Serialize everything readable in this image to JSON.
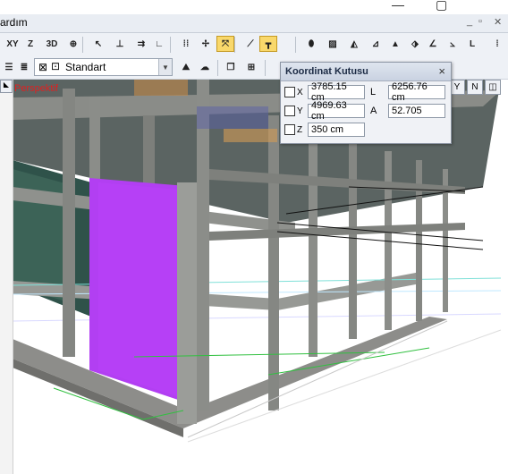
{
  "menu": {
    "partial_label": "ardım"
  },
  "toolbar1": {
    "tools": [
      {
        "name": "view-xy-tool",
        "text": "XY"
      },
      {
        "name": "view-z-tool",
        "text": "Z"
      },
      {
        "name": "view-3d-tool",
        "text": "3D"
      },
      {
        "name": "target-tool",
        "text": "⊕"
      },
      {
        "name": "select-tool",
        "text": "↖"
      },
      {
        "name": "column-tool",
        "text": "⊥"
      },
      {
        "name": "beam-tool",
        "text": "⇉"
      },
      {
        "name": "corner-tool",
        "text": "∟"
      },
      {
        "name": "grid-tool",
        "text": "⁞⁞"
      },
      {
        "name": "snap-tool",
        "text": "✢"
      },
      {
        "name": "pointer-active-tool",
        "text": "⤧"
      },
      {
        "name": "line-tool",
        "text": "⟋"
      },
      {
        "name": "axis-active-tool",
        "text": "┳"
      },
      {
        "name": "object-tool",
        "text": "⬮"
      },
      {
        "name": "hatch-tool",
        "text": "▨"
      },
      {
        "name": "slab-tool",
        "text": "◭"
      },
      {
        "name": "stair-tool",
        "text": "⊿"
      },
      {
        "name": "wall-tool",
        "text": "▲"
      },
      {
        "name": "label-tool",
        "text": "⬗"
      },
      {
        "name": "dim-tool",
        "text": "∠"
      },
      {
        "name": "angle-tool",
        "text": "⦣"
      },
      {
        "name": "measure-tool",
        "text": "L"
      },
      {
        "name": "more-tool",
        "text": "⁞"
      }
    ]
  },
  "toolbar2": {
    "style_select": {
      "value": "Standart"
    }
  },
  "viewport": {
    "label": "Perspektif",
    "view_tools": [
      "Y",
      "N",
      "◫"
    ]
  },
  "coord_box": {
    "title": "Koordinat Kutusu",
    "close": "×",
    "rows": [
      {
        "axis": "X",
        "value": "3785.15 cm",
        "label": "L",
        "label_value": "6256.76 cm"
      },
      {
        "axis": "Y",
        "value": "4969.63 cm",
        "label": "A",
        "label_value": "52.705"
      },
      {
        "axis": "Z",
        "value": "350 cm"
      }
    ]
  },
  "colors": {
    "accent_wall": "#b23ff2",
    "active_tool": "#f9d86b",
    "concrete": "#9b9b97",
    "grid_green": "#31c040"
  }
}
